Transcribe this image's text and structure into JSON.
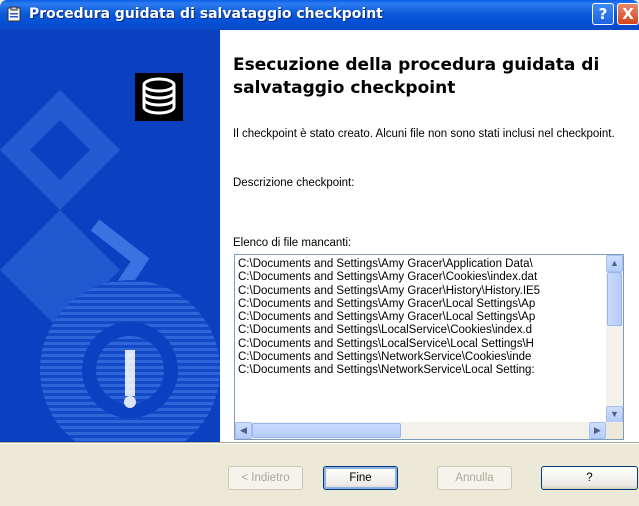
{
  "window": {
    "title": "Procedura guidata di salvataggio checkpoint",
    "help_glyph": "?",
    "close_glyph": "X"
  },
  "content": {
    "heading": "Esecuzione della procedura guidata di salvataggio checkpoint",
    "message": "Il checkpoint è stato creato. Alcuni file non sono stati inclusi nel checkpoint.",
    "description_label": "Descrizione checkpoint:",
    "missing_files_label": "Elenco di file mancanti:",
    "missing_files": [
      "C:\\Documents and Settings\\Amy Gracer\\Application Data\\",
      "C:\\Documents and Settings\\Amy Gracer\\Cookies\\index.dat",
      "C:\\Documents and Settings\\Amy Gracer\\History\\History.IE5",
      "C:\\Documents and Settings\\Amy Gracer\\Local Settings\\Ap",
      "C:\\Documents and Settings\\Amy Gracer\\Local Settings\\Ap",
      "C:\\Documents and Settings\\LocalService\\Cookies\\index.d",
      "C:\\Documents and Settings\\LocalService\\Local Settings\\H",
      "C:\\Documents and Settings\\NetworkService\\Cookies\\inde",
      "C:\\Documents and Settings\\NetworkService\\Local Setting:"
    ]
  },
  "buttons": {
    "back": "< Indietro",
    "finish": "Fine",
    "cancel": "Annulla",
    "help": "?"
  },
  "scroll_glyphs": {
    "up": "▲",
    "down": "▼",
    "left": "◀",
    "right": "▶"
  },
  "colors": {
    "titlebar": "#0a5fe8",
    "side_panel": "#0a3fbf",
    "button_border": "#003c74"
  }
}
